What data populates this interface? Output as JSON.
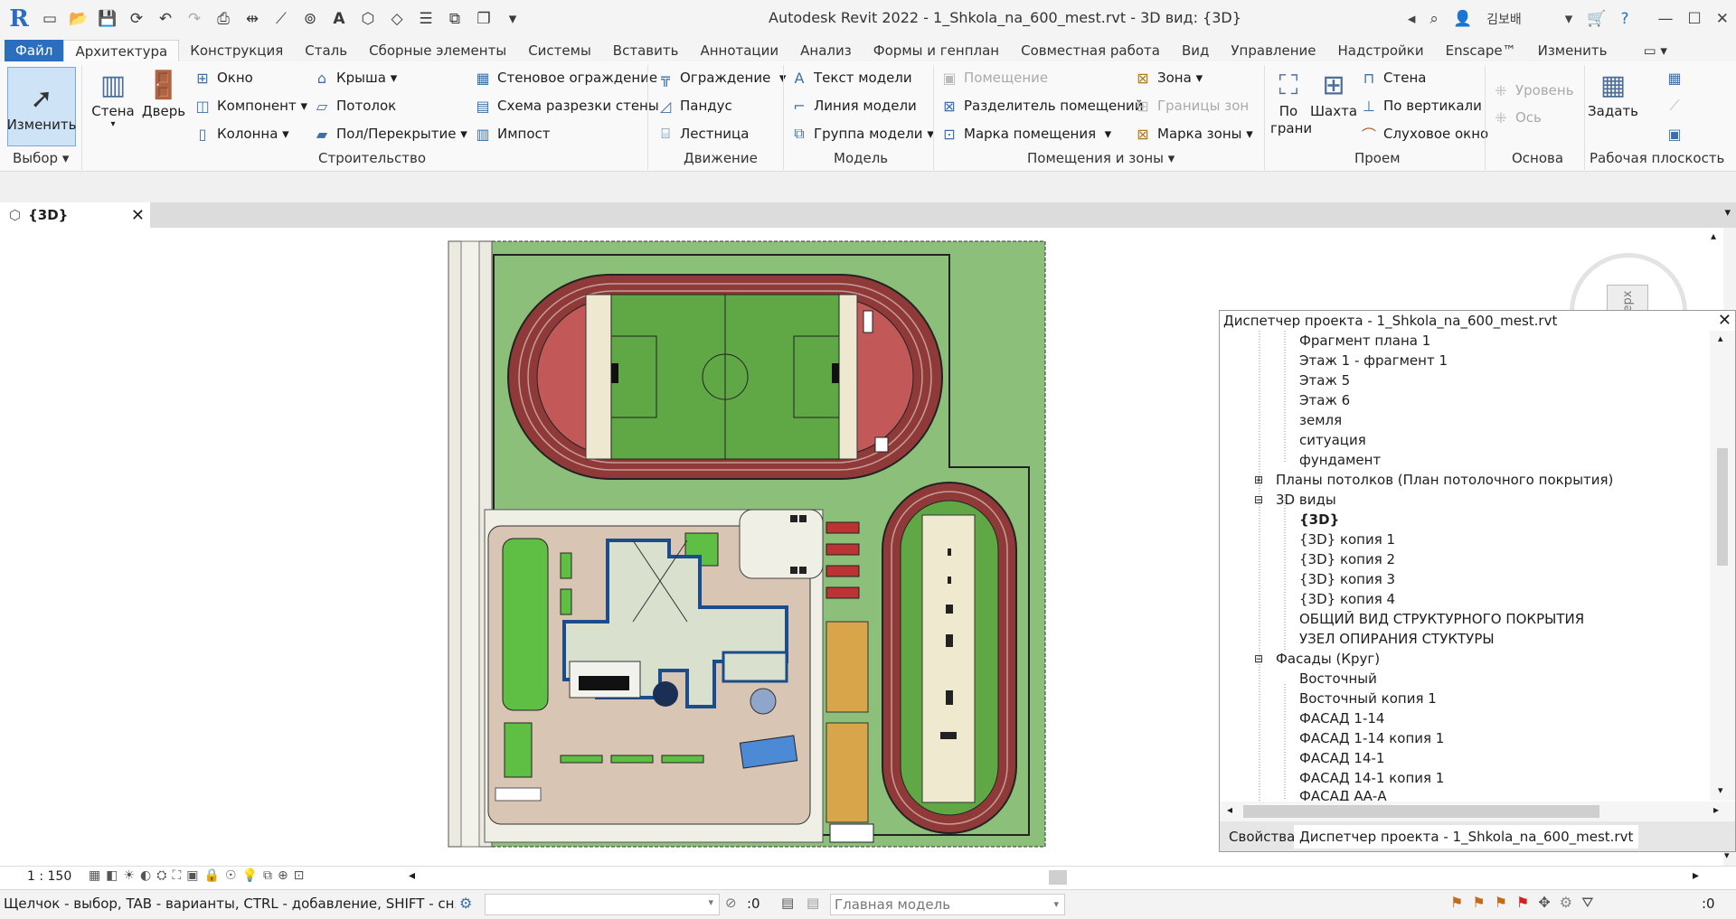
{
  "window": {
    "title": "Autodesk Revit 2022 - 1_Shkola_na_600_mest.rvt - 3D вид: {3D}",
    "user": "김보배"
  },
  "tabs": [
    {
      "label": "Файл"
    },
    {
      "label": "Архитектура"
    },
    {
      "label": "Конструкция"
    },
    {
      "label": "Сталь"
    },
    {
      "label": "Сборные элементы"
    },
    {
      "label": "Системы"
    },
    {
      "label": "Вставить"
    },
    {
      "label": "Аннотации"
    },
    {
      "label": "Анализ"
    },
    {
      "label": "Формы и генплан"
    },
    {
      "label": "Совместная работа"
    },
    {
      "label": "Вид"
    },
    {
      "label": "Управление"
    },
    {
      "label": "Надстройки"
    },
    {
      "label": "Enscape™"
    },
    {
      "label": "Изменить"
    }
  ],
  "ribbon": {
    "select": {
      "modify": "Изменить",
      "panel": "Выбор"
    },
    "build": {
      "wall": "Стена",
      "door": "Дверь",
      "window": "Окно",
      "component": "Компонент",
      "column": "Колонна",
      "roof": "Крыша",
      "ceiling": "Потолок",
      "floor": "Пол/Перекрытие",
      "curtain_system": "Стеновое ограждение",
      "curtain_grid": "Схема разрезки стены",
      "mullion": "Импост",
      "panel": "Строительство"
    },
    "circulation": {
      "railing": "Ограждение",
      "ramp": "Пандус",
      "stair": "Лестница",
      "panel": "Движение"
    },
    "model": {
      "model_text": "Текст модели",
      "model_line": "Линия модели",
      "model_group": "Группа модели",
      "panel": "Модель"
    },
    "room": {
      "room": "Помещение",
      "separator": "Разделитель помещений",
      "tag_room": "Марка помещения",
      "area": "Зона",
      "area_boundary": "Границы зон",
      "tag_area": "Марка зоны",
      "panel": "Помещения и зоны"
    },
    "opening": {
      "by_face": "По грани",
      "shaft": "Шахта",
      "wall": "Стена",
      "vertical": "По вертикали",
      "dormer": "Слуховое окно",
      "panel": "Проем"
    },
    "datum": {
      "level": "Уровень",
      "grid": "Ось",
      "panel": "Основа"
    },
    "workplane": {
      "set": "Задать",
      "panel": "Рабочая плоскость"
    }
  },
  "view_tab": {
    "label": "{3D}"
  },
  "project_browser": {
    "title": "Диспетчер проекта - 1_Shkola_na_600_mest.rvt",
    "items": [
      {
        "label": "Фрагмент плана 1"
      },
      {
        "label": "Этаж 1 - фрагмент 1"
      },
      {
        "label": "Этаж 5"
      },
      {
        "label": "Этаж 6"
      },
      {
        "label": "земля"
      },
      {
        "label": "ситуация"
      },
      {
        "label": "фундамент"
      },
      {
        "label": "Планы потолков (План потолочного покрытия)"
      },
      {
        "label": "3D виды"
      },
      {
        "label": "{3D}"
      },
      {
        "label": "{3D} копия 1"
      },
      {
        "label": "{3D} копия 2"
      },
      {
        "label": "{3D} копия 3"
      },
      {
        "label": "{3D} копия 4"
      },
      {
        "label": "ОБЩИЙ ВИД СТРУКТУРНОГО ПОКРЫТИЯ"
      },
      {
        "label": "УЗЕЛ ОПИРАНИЯ СТУКТУРЫ"
      },
      {
        "label": "Фасады (Круг)"
      },
      {
        "label": "Восточный"
      },
      {
        "label": "Восточный копия 1"
      },
      {
        "label": "ФАСАД 1-14"
      },
      {
        "label": "ФАСАД 1-14 копия 1"
      },
      {
        "label": "ФАСАД 14-1"
      },
      {
        "label": "ФАСАД 14-1 копия 1"
      },
      {
        "label": "ФАСАД АА-А"
      }
    ],
    "tab_properties": "Свойства",
    "tab_browser": "Диспетчер проекта - 1_Shkola_na_600_mest.rvt"
  },
  "view_controls": {
    "scale": "1 : 150"
  },
  "viewcube": {
    "face": "Верх"
  },
  "status": {
    "hint": "Щелчок - выбор, TAB - варианты, CTRL - добавление, SHIFT - снятие вь",
    "sel_count": ":0",
    "model": "Главная модель",
    "filter_count": ":0"
  },
  "colors": {
    "accent": "#2a6ebd",
    "grass": "#8cbf7a",
    "track": "#8f3a38",
    "field": "#5fa845"
  }
}
